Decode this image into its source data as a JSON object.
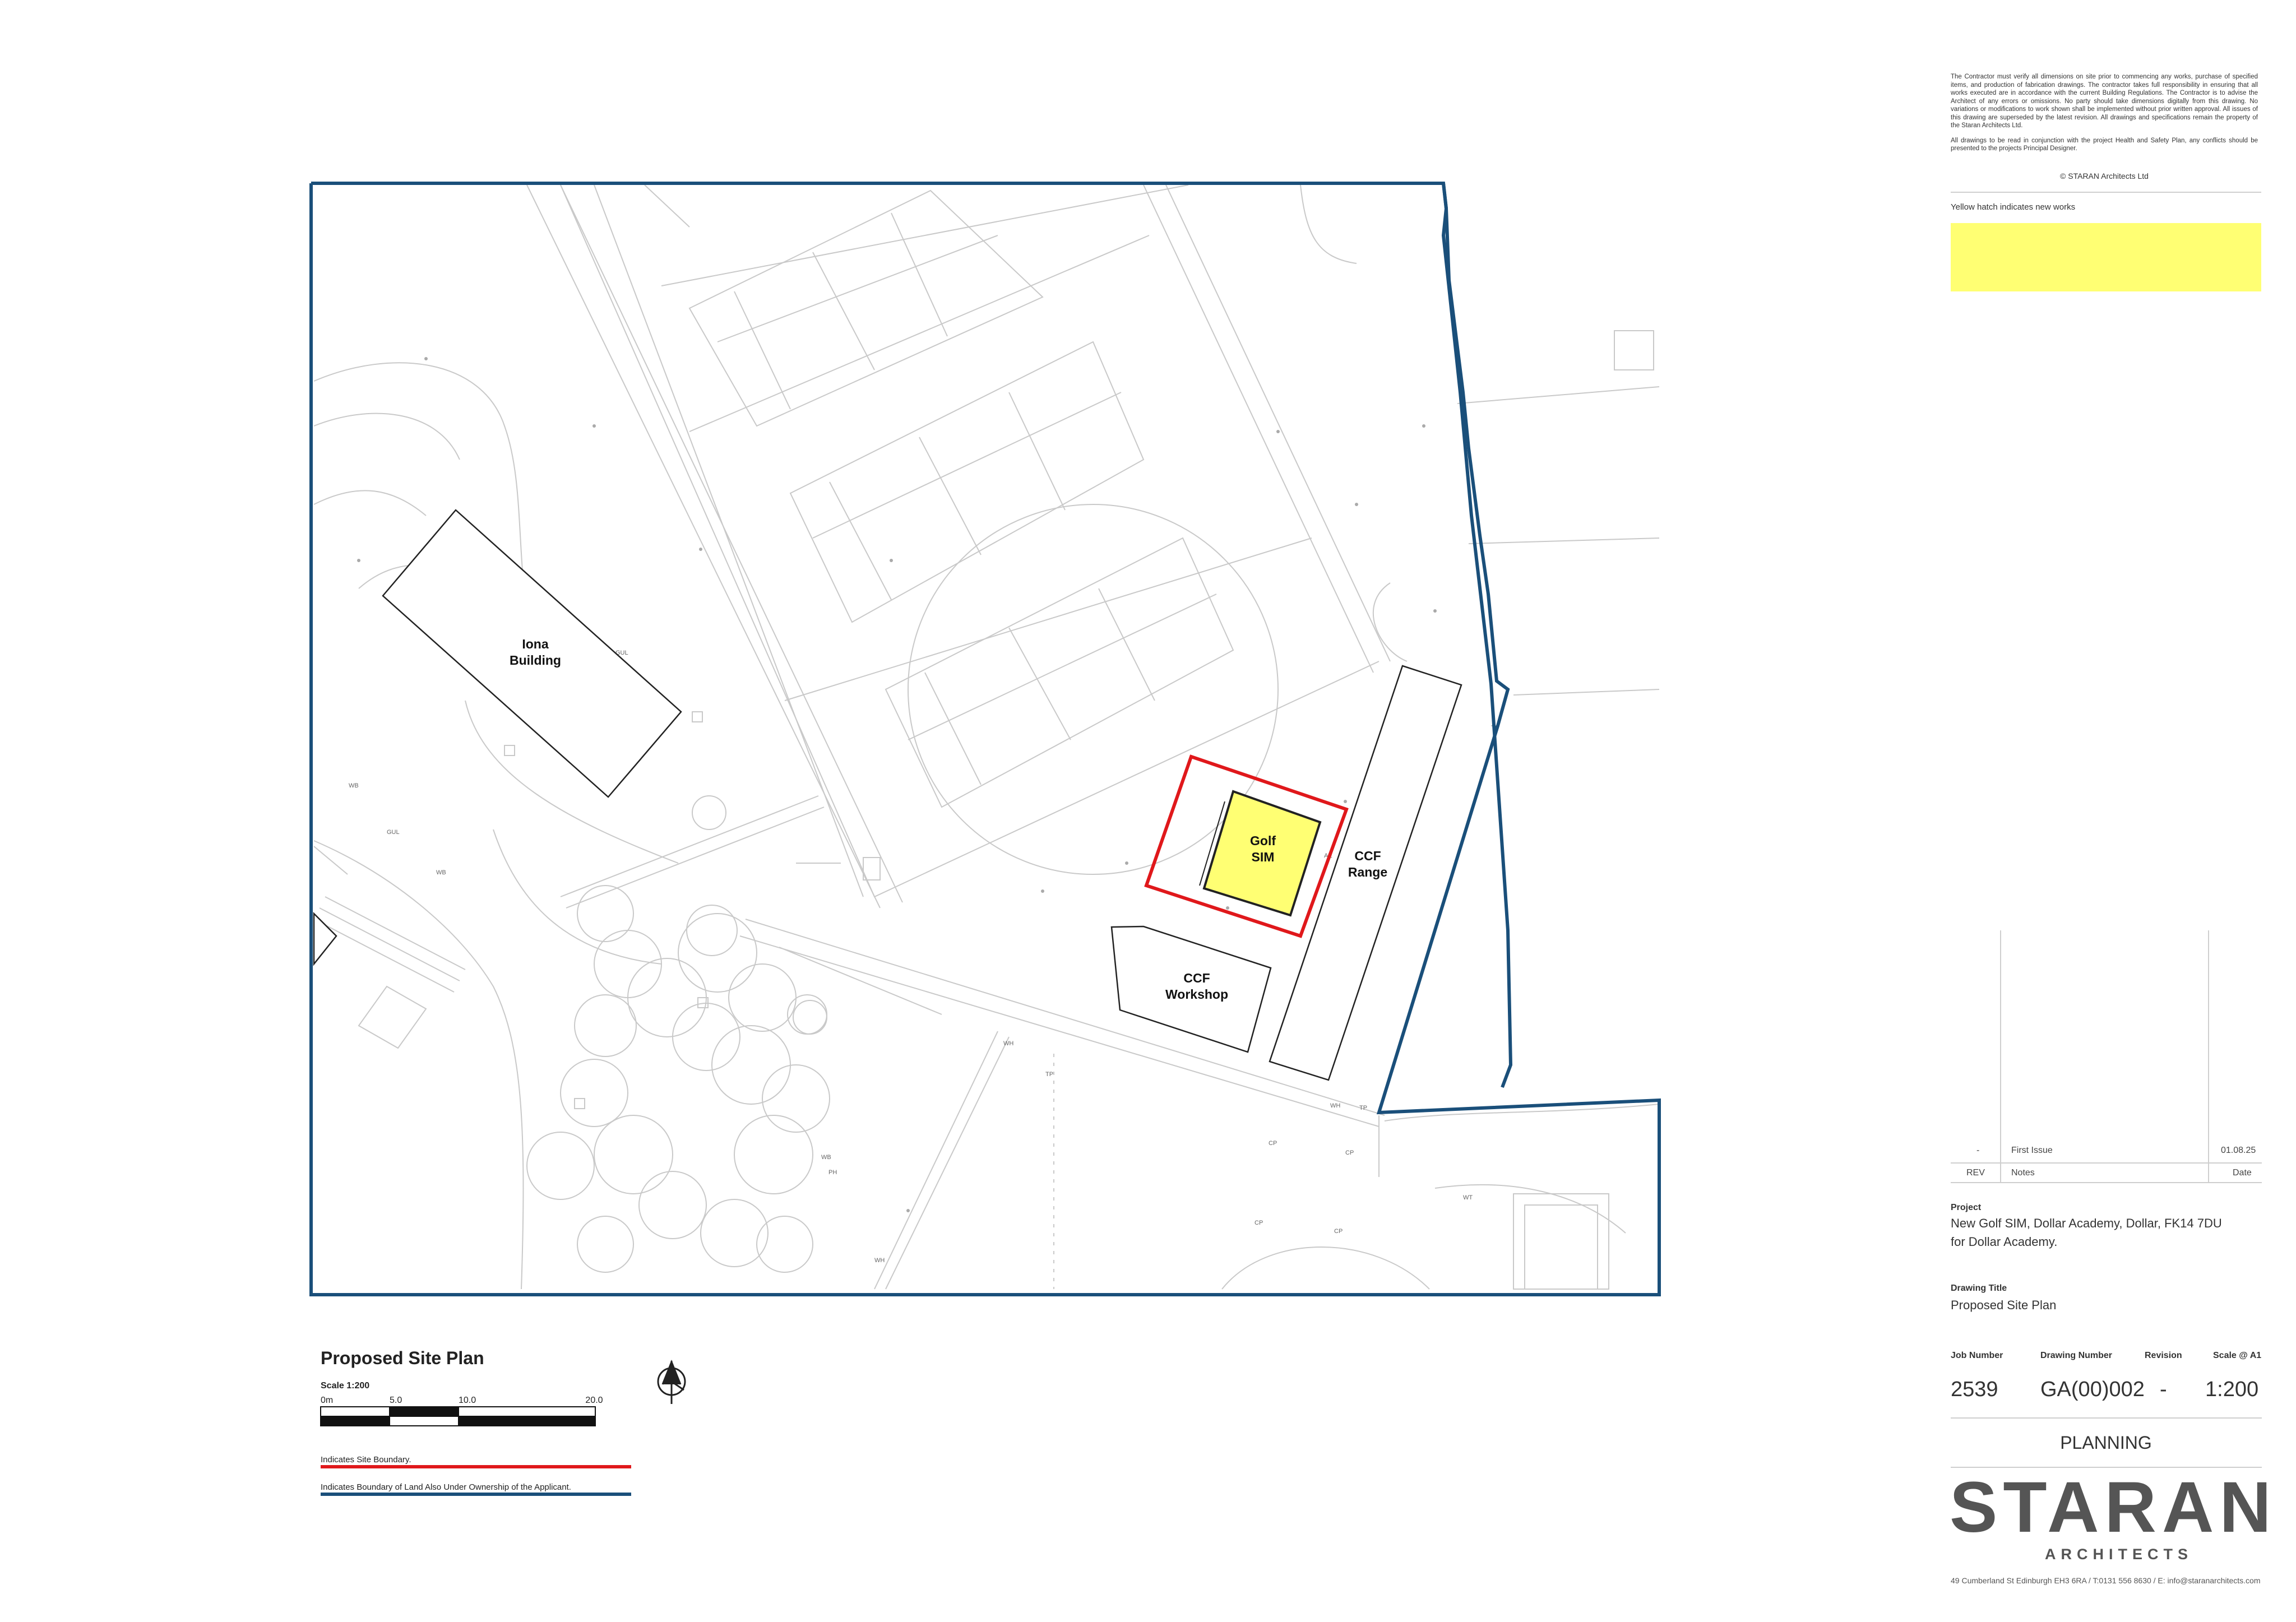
{
  "notes": {
    "disclaimer": "The Contractor must verify all dimensions on site prior to commencing any works, purchase of specified items, and production of fabrication drawings.  The contractor takes full responsibility in ensuring that all works executed are in accordance with the current Building Regulations. The Contractor is to advise the Architect of any errors or omissions.  No party should take dimensions digitally from this drawing.  No variations or modifications to work shown shall be implemented without prior written approval.  All issues of this drawing are superseded by the latest revision.  All drawings and specifications remain the property of the Staran Architects Ltd.",
    "hs_note": "All drawings to be read in conjunction with the project Health and Safety Plan, any conflicts should be presented to the projects Principal Designer.",
    "copyright": "© STARAN Architects Ltd",
    "hatch_note": "Yellow hatch indicates new works"
  },
  "colors": {
    "site_boundary": "#e0181b",
    "ownership_boundary": "#1a4f7a",
    "new_works_hatch": "#ffff73"
  },
  "plan": {
    "buildings": {
      "iona": [
        "Iona",
        "Building"
      ],
      "golf": [
        "Golf",
        "SIM"
      ],
      "range": [
        "CCF",
        "Range"
      ],
      "workshop": [
        "CCF",
        "Workshop"
      ]
    },
    "small_labels": [
      "WB",
      "GUL",
      "WB",
      "GUL",
      "WH",
      "TP",
      "WH",
      "TP",
      "CP",
      "CP",
      "CP",
      "CP",
      "WT",
      "PH",
      "WB",
      "WH",
      "TP",
      "AE"
    ]
  },
  "legend": {
    "title": "Proposed Site Plan",
    "scale": "Scale 1:200",
    "scale_marks": [
      "0m",
      "5.0",
      "10.0",
      "20.0"
    ],
    "site_boundary": "Indicates Site Boundary.",
    "ownership_boundary": "Indicates Boundary of Land Also Under Ownership of the Applicant."
  },
  "title_block": {
    "revisions": [
      {
        "rev": "-",
        "notes": "First Issue",
        "date": "01.08.25"
      }
    ],
    "rev_header": "REV",
    "notes_header": "Notes",
    "date_header": "Date",
    "project_label": "Project",
    "project_line1": "New Golf SIM, Dollar Academy, Dollar, FK14 7DU",
    "project_line2": "for Dollar Academy.",
    "drawing_title_label": "Drawing Title",
    "drawing_title": "Proposed Site Plan",
    "job_number_label": "Job Number",
    "drawing_number_label": "Drawing Number",
    "revision_label": "Revision",
    "scale_label": "Scale @ A1",
    "job_number": "2539",
    "drawing_number": "GA(00)002",
    "revision": "-",
    "scale": "1:200",
    "status": "PLANNING",
    "logo": "STARAN",
    "logo_sub": "ARCHITECTS",
    "address": "49 Cumberland St Edinburgh EH3 6RA  /  T:0131 556 8630  /  E: info@staranarchitects.com"
  }
}
